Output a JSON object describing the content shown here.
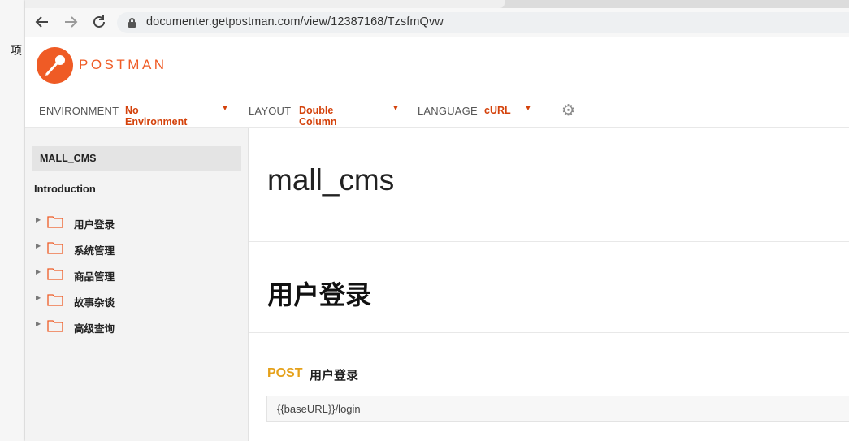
{
  "left_edge": {
    "stub_text": "项"
  },
  "browser": {
    "back_icon": "arrow-left-icon",
    "forward_icon": "arrow-right-icon",
    "reload_icon": "reload-icon",
    "url": "documenter.getpostman.com/view/12387168/TzsfmQvw"
  },
  "postman": {
    "brand": "POSTMAN",
    "brand_color": "#EF5B25",
    "settings": [
      {
        "label": "ENVIRONMENT",
        "value": "No Environment"
      },
      {
        "label": "LAYOUT",
        "value": "Double Column"
      },
      {
        "label": "LANGUAGE",
        "value": "cURL"
      }
    ],
    "settings_icon": "gear-icon"
  },
  "sidebar": {
    "collection": "MALL_CMS",
    "intro": "Introduction",
    "folders": [
      {
        "name": "用户登录"
      },
      {
        "name": "系统管理"
      },
      {
        "name": "商品管理"
      },
      {
        "name": "故事杂谈"
      },
      {
        "name": "高级查询"
      }
    ]
  },
  "main": {
    "title": "mall_cms",
    "section": "用户登录",
    "request": {
      "method": "POST",
      "method_color": "#E5A11A",
      "name": "用户登录",
      "url": "{{baseURL}}/login"
    }
  }
}
